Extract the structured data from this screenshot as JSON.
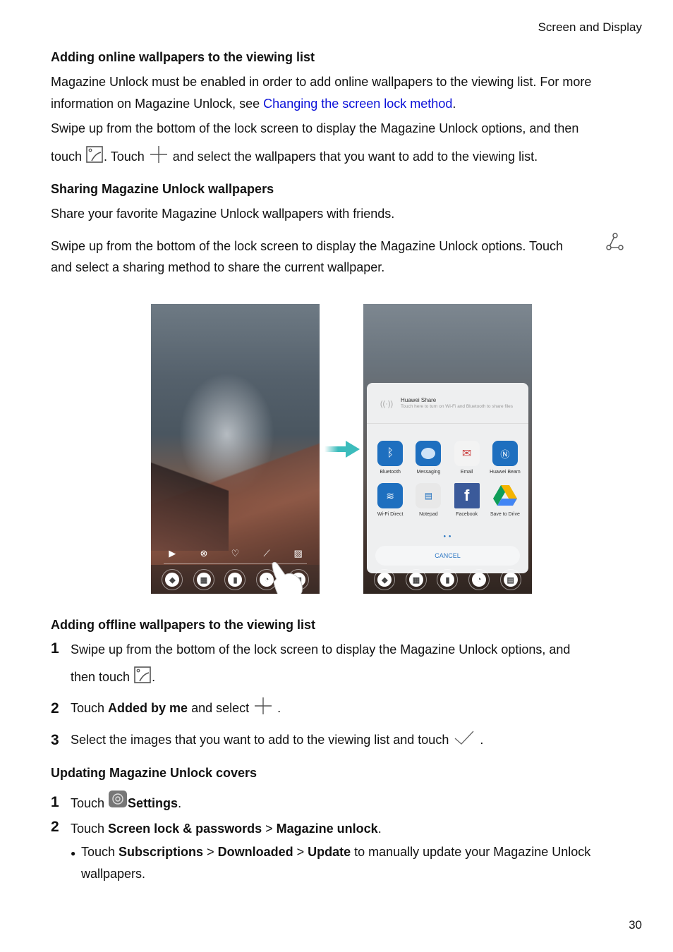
{
  "header": {
    "section": "Screen and Display"
  },
  "online": {
    "heading": "Adding online wallpapers to the viewing list",
    "p1_line1": "Magazine Unlock must be enabled in order to add online wallpapers to the viewing list. For more",
    "p1_line2_pre": "information on Magazine Unlock, see ",
    "p1_link": "Changing the screen lock method",
    "p1_line2_post": ".",
    "p2_line1": "Swipe up from the bottom of the lock screen to display the Magazine Unlock options, and then",
    "p2_touch": "touch ",
    "p2_mid": ". Touch ",
    "p2_end": " and select the wallpapers that you want to add to the viewing list."
  },
  "sharing": {
    "heading": "Sharing Magazine Unlock wallpapers",
    "p1": "Share your favorite Magazine Unlock wallpapers with friends.",
    "p2_line1": "Swipe up from the bottom of the lock screen to display the Magazine Unlock options. Touch",
    "p2_line2": "and select a sharing method to share the current wallpaper."
  },
  "figure": {
    "share_sheet": {
      "huawei_share_title": "Huawei Share",
      "huawei_share_sub": "Touch here to turn on Wi-Fi and Bluetooth to share files",
      "apps": [
        {
          "label": "Bluetooth",
          "icon": "bluetooth-icon",
          "color": "#1e6fbf"
        },
        {
          "label": "Messaging",
          "icon": "message-bubble-icon",
          "color": "#1e6fbf"
        },
        {
          "label": "Email",
          "icon": "envelope-icon",
          "color": "#f3f3f3"
        },
        {
          "label": "Huawei Beam",
          "icon": "nfc-icon",
          "color": "#1e6fbf"
        },
        {
          "label": "Wi-Fi Direct",
          "icon": "wifi-direct-icon",
          "color": "#1e6fbf"
        },
        {
          "label": "Notepad",
          "icon": "notepad-icon",
          "color": "#e8e8e8"
        },
        {
          "label": "Facebook",
          "icon": "facebook-icon",
          "color": "#3b5a9a"
        },
        {
          "label": "Save to Drive",
          "icon": "google-drive-icon",
          "color": "#ffffff"
        }
      ],
      "page_dots": "● ●",
      "cancel": "CANCEL"
    },
    "accent_arrow": "#3cbcbc"
  },
  "offline": {
    "heading": "Adding offline wallpapers to the viewing list",
    "steps": [
      {
        "num": "1",
        "line1": "Swipe up from the bottom of the lock screen to display the Magazine Unlock options, and",
        "line2_pre": "then touch ",
        "line2_post": "."
      },
      {
        "num": "2",
        "pre": "Touch ",
        "bold": "Added by me",
        "mid": " and select ",
        "post": " ."
      },
      {
        "num": "3",
        "pre": "Select the images that you want to add to the viewing list and touch ",
        "post": " ."
      }
    ]
  },
  "covers": {
    "heading": "Updating Magazine Unlock covers",
    "steps": [
      {
        "num": "1",
        "pre": "Touch ",
        "bold": "Settings",
        "post": "."
      },
      {
        "num": "2",
        "pre": "Touch ",
        "bold1": "Screen lock & passwords",
        "sep": " > ",
        "bold2": "Magazine unlock",
        "post": "."
      }
    ],
    "bullet": {
      "pre": "Touch ",
      "b1": "Subscriptions",
      "sep1": " > ",
      "b2": "Downloaded",
      "sep2": " > ",
      "b3": "Update",
      "post_line1": " to manually update your Magazine Unlock",
      "line2": "wallpapers."
    }
  },
  "footer": {
    "page_number": "30"
  }
}
